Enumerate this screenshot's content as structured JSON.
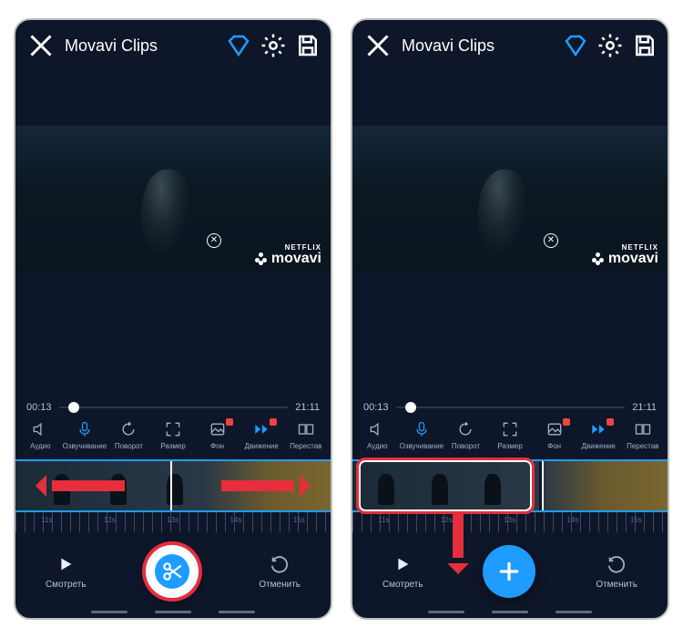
{
  "app": {
    "title": "Movavi Clips"
  },
  "watermark": {
    "brand_small": "NETFLIX",
    "brand_main": "movavi"
  },
  "time": {
    "current": "00:13",
    "total": "21:11"
  },
  "tools": [
    {
      "id": "audio",
      "label": "Аудио"
    },
    {
      "id": "voice",
      "label": "Озвучивание"
    },
    {
      "id": "rotate",
      "label": "Поворот"
    },
    {
      "id": "size",
      "label": "Размер"
    },
    {
      "id": "bg",
      "label": "Фон",
      "badge": true
    },
    {
      "id": "motion",
      "label": "Движение",
      "badge": true
    },
    {
      "id": "reorder",
      "label": "Перестав"
    }
  ],
  "ruler": {
    "marks": [
      "11s",
      "12s",
      "13s",
      "14s",
      "15s"
    ]
  },
  "bottom": {
    "watch": "Смотреть",
    "cancel": "Отменить"
  },
  "panes": {
    "left": {
      "fab": "cut",
      "playhead_pct": 49,
      "dot_pct": 4
    },
    "right": {
      "fab": "plus",
      "playhead_pct": 60,
      "dot_pct": 4
    }
  }
}
